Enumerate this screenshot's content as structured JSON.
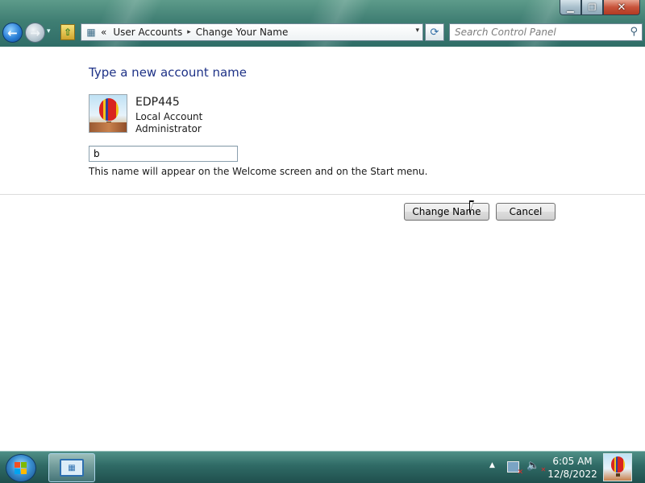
{
  "window": {
    "minimize_glyph": "▁",
    "maximize_glyph": "❐",
    "close_glyph": "✕"
  },
  "nav": {
    "back_glyph": "←",
    "forward_glyph": "→",
    "recent_glyph": "▾",
    "up_glyph": "⇧"
  },
  "address": {
    "overflow_glyph": "«",
    "crumbs": [
      "User Accounts",
      "Change Your Name"
    ],
    "separator": "▸",
    "dropdown_glyph": "▾",
    "refresh_glyph": "⟳"
  },
  "search": {
    "placeholder": "Search Control Panel",
    "value": ""
  },
  "content": {
    "heading": "Type a new account name",
    "account_name": "EDP445",
    "account_type": "Local Account",
    "account_role": "Administrator",
    "new_name_value": "b",
    "hint": "This name will appear on the Welcome screen and on the Start menu.",
    "change_name_label": "Change Name",
    "cancel_label": "Cancel"
  },
  "taskbar": {
    "control_panel_glyph": "▦",
    "tray_overflow_glyph": "▲",
    "volume_glyph": "🔈",
    "time": "6:05 AM",
    "date": "12/8/2022"
  },
  "colors": {
    "heading": "#1e3287",
    "glass": "#3f7e73",
    "taskbar": "#2f6a65"
  },
  "icons": [
    "back-arrow-icon",
    "forward-arrow-icon",
    "control-panel-icon",
    "refresh-icon",
    "search-icon",
    "user-picture-balloon",
    "network-icon",
    "volume-muted-icon",
    "windows-start-icon"
  ]
}
